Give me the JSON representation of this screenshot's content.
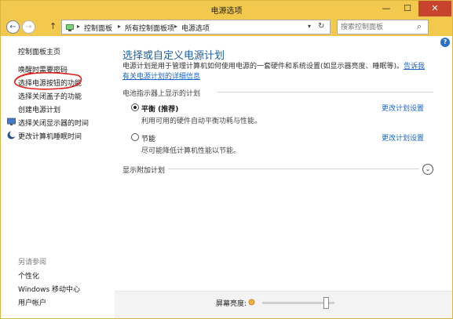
{
  "window": {
    "title": "电源选项",
    "minimize": "—",
    "maximize": "☐",
    "close": "✕"
  },
  "nav": {
    "back": "←",
    "forward": "→",
    "up": "↑",
    "breadcrumb": [
      "控制面板",
      "所有控制面板项",
      "电源选项"
    ],
    "separator": "▸",
    "search_placeholder": "搜索控制面板"
  },
  "sidebar": {
    "items": [
      {
        "label": "控制面板主页"
      },
      {
        "label": "唤醒时需要密码"
      },
      {
        "label": "选择电源按钮的功能"
      },
      {
        "label": "选择关闭盖子的功能"
      },
      {
        "label": "创建电源计划"
      },
      {
        "label": "选择关闭显示器的时间",
        "icon": "monitor-icon"
      },
      {
        "label": "更改计算机睡眠时间",
        "icon": "moon-icon"
      }
    ],
    "see_also": {
      "heading": "另请参阅",
      "items": [
        {
          "label": "个性化"
        },
        {
          "label": "Windows 移动中心"
        },
        {
          "label": "用户帐户"
        }
      ]
    }
  },
  "main": {
    "heading": "选择或自定义电源计划",
    "description": "电源计划是用于管理计算机如何使用电源的一套硬件和系统设置(如显示器亮度、睡眠等)。",
    "description_link": "告诉我有关电源计划的详细信息",
    "group_label": "电池指示器上显示的计划",
    "plans": [
      {
        "name": "平衡 (推荐)",
        "description": "利用可用的硬件自动平衡功耗与性能。",
        "change": "更改计划设置",
        "selected": true
      },
      {
        "name": "节能",
        "description": "尽可能降低计算机性能以节能。",
        "change": "更改计划设置",
        "selected": false
      }
    ],
    "more_plans": "显示附加计划",
    "expander_icon": "⌄"
  },
  "bottom": {
    "brightness_label": "屏幕亮度:",
    "brightness_level": 0.92
  },
  "colors": {
    "titlebar": "#f2c94c",
    "close": "#c7432d",
    "link": "#1a64c4",
    "heading": "#1d5f9e",
    "annotation": "#e0201b"
  }
}
